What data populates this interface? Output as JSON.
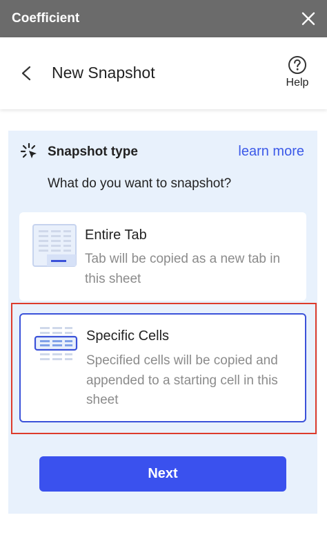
{
  "titlebar": {
    "app_title": "Coefficient",
    "close_icon": "close-icon"
  },
  "header": {
    "title": "New Snapshot",
    "back_icon": "chevron-left-icon",
    "help_label": "Help",
    "help_icon": "question-circle-icon"
  },
  "section": {
    "icon": "sparkle-icon",
    "title": "Snapshot type",
    "learn_more": "learn more",
    "question": "What do you want to snapshot?"
  },
  "options": [
    {
      "title": "Entire Tab",
      "description": "Tab will be copied as a new tab in this sheet",
      "icon": "sheet-tab-icon",
      "selected": false
    },
    {
      "title": "Specific Cells",
      "description": "Specified cells will be copied and appended to a starting cell in this sheet",
      "icon": "cell-range-icon",
      "selected": true
    }
  ],
  "next_button": {
    "label": "Next"
  },
  "colors": {
    "titlebar_bg": "#6b6b6b",
    "panel_bg": "#e8f1fc",
    "accent": "#3a51ee",
    "link": "#3b59e8",
    "highlight": "#dd3b2b"
  }
}
